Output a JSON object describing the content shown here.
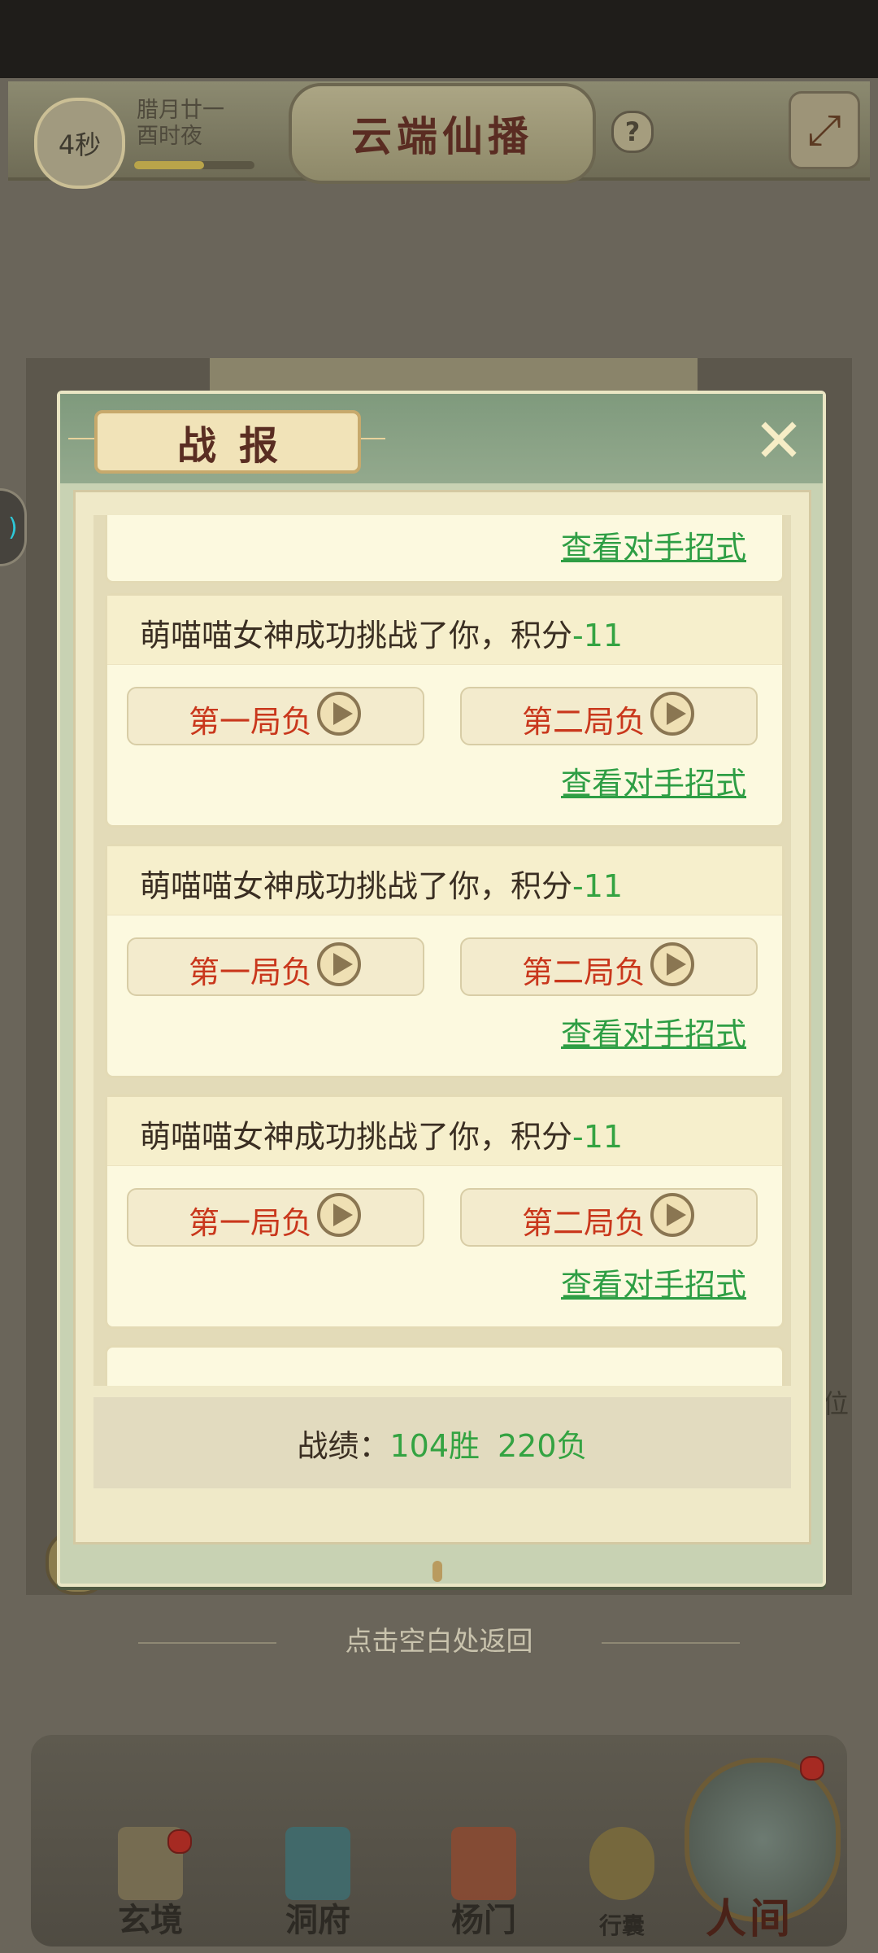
{
  "header": {
    "timer": "4秒",
    "date_line1": "腊月廿一",
    "date_line2": "酉时夜",
    "time_progress": 0.58,
    "title": "云端仙播",
    "help": "?"
  },
  "background": {
    "right_label": "位"
  },
  "dialog": {
    "title": "战报",
    "partial_top_link": "查看对手招式",
    "entries": [
      {
        "text": "萌喵喵女神成功挑战了你，积分",
        "score": "-11",
        "round1": "第一局负",
        "round2": "第二局负",
        "link": "查看对手招式"
      },
      {
        "text": "萌喵喵女神成功挑战了你，积分",
        "score": "-11",
        "round1": "第一局负",
        "round2": "第二局负",
        "link": "查看对手招式"
      },
      {
        "text": "萌喵喵女神成功挑战了你，积分",
        "score": "-11",
        "round1": "第一局负",
        "round2": "第二局负",
        "link": "查看对手招式"
      }
    ],
    "record_label": "战绩：",
    "record_wins": "104胜",
    "record_losses": "220负"
  },
  "return_hint": "点击空白处返回",
  "nav": {
    "items": [
      "玄境",
      "洞府",
      "杨门",
      "行囊"
    ],
    "main": "人间"
  },
  "colors": {
    "dialog_header": "#7f9a7d",
    "card_bg": "#fcf9df",
    "loss_red": "#c9371c",
    "score_green": "#34a342"
  }
}
